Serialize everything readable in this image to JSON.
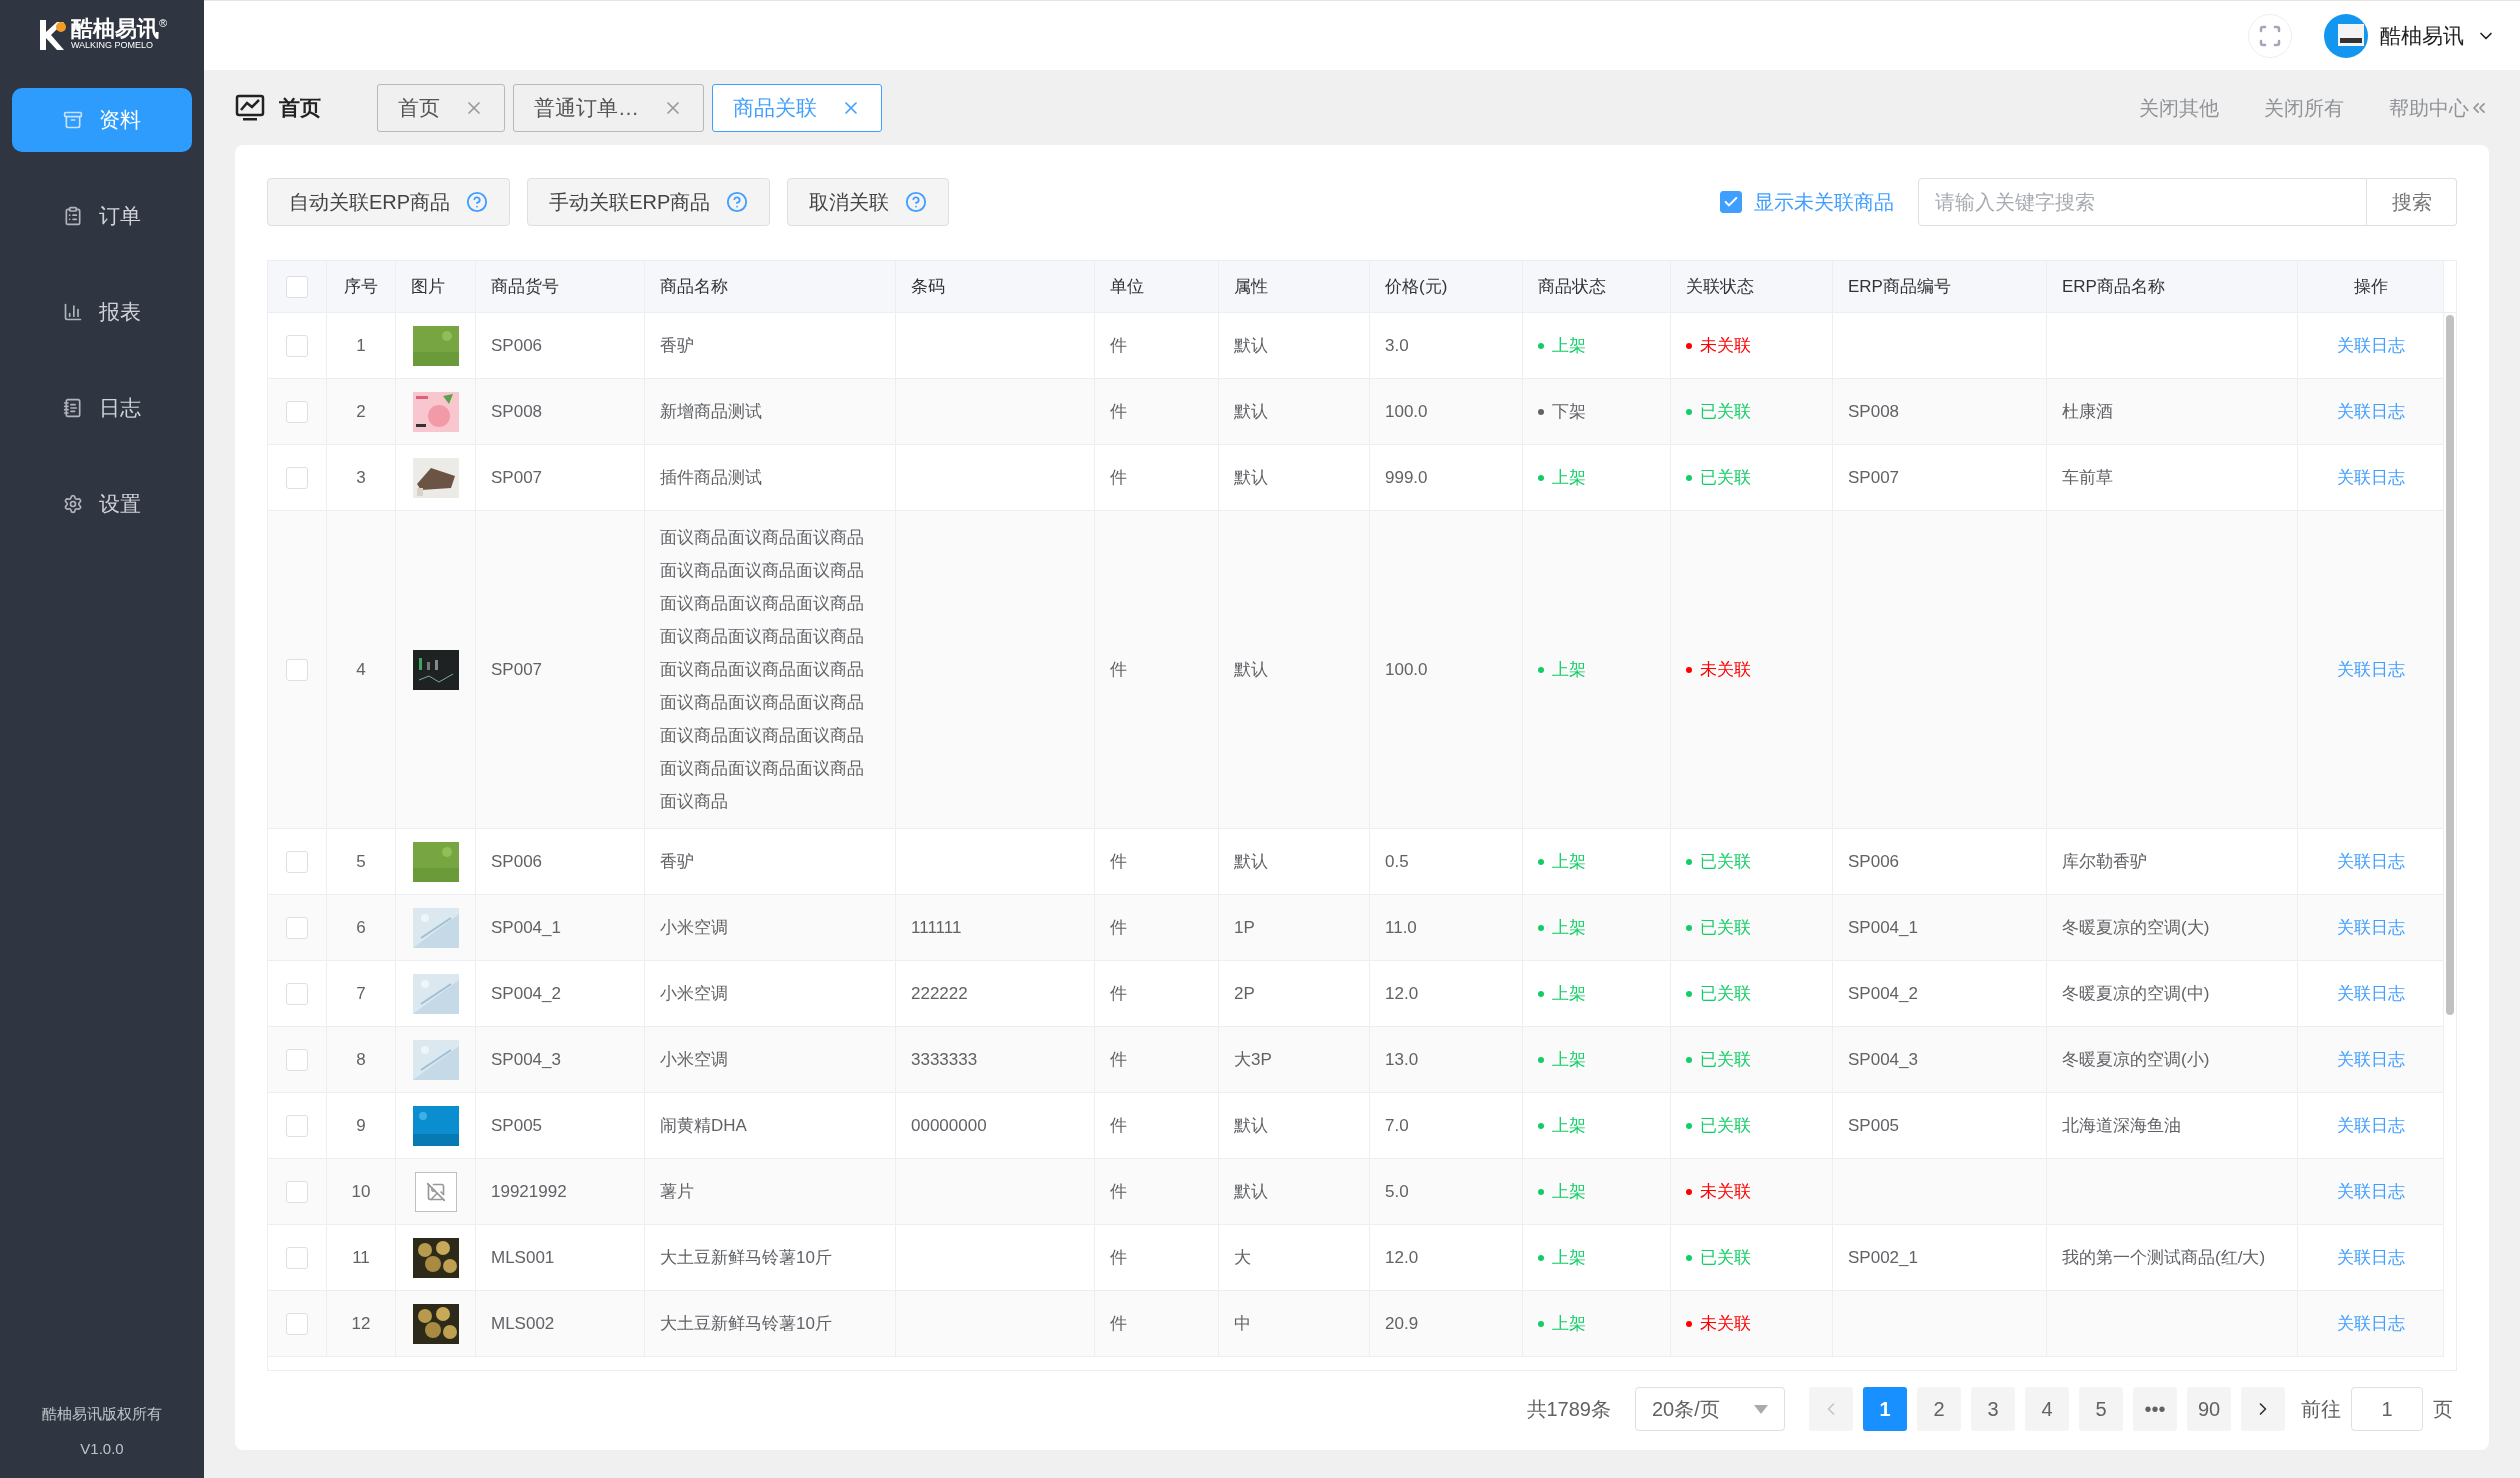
{
  "sidebar": {
    "logo": {
      "name": "酷柚易讯",
      "mark": "®",
      "tagline": "WALKING POMELO"
    },
    "items": [
      {
        "label": "资料",
        "selected": true
      },
      {
        "label": "订单",
        "selected": false
      },
      {
        "label": "报表",
        "selected": false
      },
      {
        "label": "日志",
        "selected": false
      },
      {
        "label": "设置",
        "selected": false
      }
    ],
    "footer": {
      "copyright": "酷柚易讯版权所有",
      "version": "V1.0.0"
    }
  },
  "header": {
    "user": "酷柚易讯"
  },
  "tabbar": {
    "home": "首页",
    "tabs": [
      {
        "label": "首页",
        "selected": false
      },
      {
        "label": "普通订单…",
        "selected": false
      },
      {
        "label": "商品关联",
        "selected": true
      }
    ],
    "actions": [
      "关闭其他",
      "关闭所有",
      "帮助中心"
    ]
  },
  "toolbar": {
    "buttons": [
      "自动关联ERP商品",
      "手动关联ERP商品",
      "取消关联"
    ],
    "filter": {
      "label": "显示未关联商品",
      "checked": true
    },
    "search": {
      "placeholder": "请输入关键字搜索",
      "button": "搜索"
    }
  },
  "table": {
    "select_all": {
      "checked": false
    },
    "columns": [
      "序号",
      "图片",
      "商品货号",
      "商品名称",
      "条码",
      "单位",
      "属性",
      "价格(元)",
      "商品状态",
      "关联状态",
      "ERP商品编号",
      "ERP商品名称",
      "操作"
    ],
    "rows": [
      {
        "checked": false,
        "no": "1",
        "sku": "SP006",
        "name": "香驴",
        "barcode": "",
        "unit": "件",
        "attr": "默认",
        "price": "3.0",
        "status": {
          "text": "上架",
          "color": "#13ce66"
        },
        "link": {
          "text": "未关联",
          "color": "#ff0000"
        },
        "erp_code": "",
        "erp_name": "",
        "action": "关联日志"
      },
      {
        "checked": false,
        "no": "2",
        "sku": "SP008",
        "name": "新增商品测试",
        "barcode": "",
        "unit": "件",
        "attr": "默认",
        "price": "100.0",
        "status": {
          "text": "下架",
          "color": "#606266"
        },
        "link": {
          "text": "已关联",
          "color": "#13ce66"
        },
        "erp_code": "SP008",
        "erp_name": "杜康酒",
        "action": "关联日志"
      },
      {
        "checked": false,
        "no": "3",
        "sku": "SP007",
        "name": "插件商品测试",
        "barcode": "",
        "unit": "件",
        "attr": "默认",
        "price": "999.0",
        "status": {
          "text": "上架",
          "color": "#13ce66"
        },
        "link": {
          "text": "已关联",
          "color": "#13ce66"
        },
        "erp_code": "SP007",
        "erp_name": "车前草",
        "action": "关联日志"
      },
      {
        "checked": false,
        "no": "4",
        "sku": "SP007",
        "name": "面议商品面议商品面议商品面议商品面议商品面议商品面议商品面议商品面议商品面议商品面议商品面议商品面议商品面议商品面议商品面议商品面议商品面议商品面议商品面议商品面议商品面议商品面议商品面议商品面议商品",
        "barcode": "",
        "unit": "件",
        "attr": "默认",
        "price": "100.0",
        "status": {
          "text": "上架",
          "color": "#13ce66"
        },
        "link": {
          "text": "未关联",
          "color": "#ff0000"
        },
        "erp_code": "",
        "erp_name": "",
        "action": "关联日志"
      },
      {
        "checked": false,
        "no": "5",
        "sku": "SP006",
        "name": "香驴",
        "barcode": "",
        "unit": "件",
        "attr": "默认",
        "price": "0.5",
        "status": {
          "text": "上架",
          "color": "#13ce66"
        },
        "link": {
          "text": "已关联",
          "color": "#13ce66"
        },
        "erp_code": "SP006",
        "erp_name": "库尔勒香驴",
        "action": "关联日志"
      },
      {
        "checked": false,
        "no": "6",
        "sku": "SP004_1",
        "name": "小米空调",
        "barcode": "111111",
        "unit": "件",
        "attr": "1P",
        "price": "11.0",
        "status": {
          "text": "上架",
          "color": "#13ce66"
        },
        "link": {
          "text": "已关联",
          "color": "#13ce66"
        },
        "erp_code": "SP004_1",
        "erp_name": "冬暖夏凉的空调(大)",
        "action": "关联日志"
      },
      {
        "checked": false,
        "no": "7",
        "sku": "SP004_2",
        "name": "小米空调",
        "barcode": "222222",
        "unit": "件",
        "attr": "2P",
        "price": "12.0",
        "status": {
          "text": "上架",
          "color": "#13ce66"
        },
        "link": {
          "text": "已关联",
          "color": "#13ce66"
        },
        "erp_code": "SP004_2",
        "erp_name": "冬暖夏凉的空调(中)",
        "action": "关联日志"
      },
      {
        "checked": false,
        "no": "8",
        "sku": "SP004_3",
        "name": "小米空调",
        "barcode": "3333333",
        "unit": "件",
        "attr": "大3P",
        "price": "13.0",
        "status": {
          "text": "上架",
          "color": "#13ce66"
        },
        "link": {
          "text": "已关联",
          "color": "#13ce66"
        },
        "erp_code": "SP004_3",
        "erp_name": "冬暖夏凉的空调(小)",
        "action": "关联日志"
      },
      {
        "checked": false,
        "no": "9",
        "sku": "SP005",
        "name": "闹黄精DHA",
        "barcode": "00000000",
        "unit": "件",
        "attr": "默认",
        "price": "7.0",
        "status": {
          "text": "上架",
          "color": "#13ce66"
        },
        "link": {
          "text": "已关联",
          "color": "#13ce66"
        },
        "erp_code": "SP005",
        "erp_name": "北海道深海鱼油",
        "action": "关联日志"
      },
      {
        "checked": false,
        "no": "10",
        "sku": "19921992",
        "name": "薯片",
        "barcode": "",
        "unit": "件",
        "attr": "默认",
        "price": "5.0",
        "status": {
          "text": "上架",
          "color": "#13ce66"
        },
        "link": {
          "text": "未关联",
          "color": "#ff0000"
        },
        "erp_code": "",
        "erp_name": "",
        "action": "关联日志"
      },
      {
        "checked": false,
        "no": "11",
        "sku": "MLS001",
        "name": "大土豆新鲜马铃薯10斤",
        "barcode": "",
        "unit": "件",
        "attr": "大",
        "price": "12.0",
        "status": {
          "text": "上架",
          "color": "#13ce66"
        },
        "link": {
          "text": "已关联",
          "color": "#13ce66"
        },
        "erp_code": "SP002_1",
        "erp_name": "我的第一个测试商品(红/大)",
        "action": "关联日志"
      },
      {
        "checked": false,
        "no": "12",
        "sku": "MLS002",
        "name": "大土豆新鲜马铃薯10斤",
        "barcode": "",
        "unit": "件",
        "attr": "中",
        "price": "20.9",
        "status": {
          "text": "上架",
          "color": "#13ce66"
        },
        "link": {
          "text": "未关联",
          "color": "#ff0000"
        },
        "erp_code": "",
        "erp_name": "",
        "action": "关联日志"
      }
    ]
  },
  "pagination": {
    "total": "共1789条",
    "page_size": "20条/页",
    "prev_disabled": true,
    "pages": [
      {
        "label": "1",
        "selected": true
      },
      {
        "label": "2",
        "selected": false
      },
      {
        "label": "3",
        "selected": false
      },
      {
        "label": "4",
        "selected": false
      },
      {
        "label": "5",
        "selected": false
      },
      {
        "label": "•••",
        "selected": false
      },
      {
        "label": "90",
        "selected": false
      }
    ],
    "goto_label": "前往",
    "goto_value": "1",
    "goto_suffix": "页"
  }
}
